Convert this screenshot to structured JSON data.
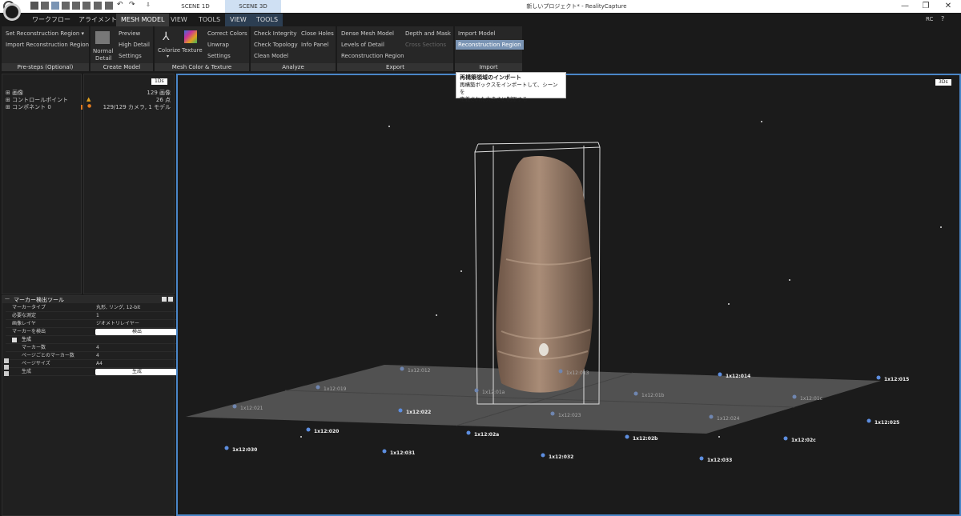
{
  "titlebar": {
    "scene_tabs": [
      "SCENE 1D",
      "SCENE 3D"
    ],
    "window_title": "新しいプロジェクト* - RealityCapture",
    "rc_label": "RC"
  },
  "menu": {
    "tabs": [
      "ワークフロー",
      "アライメント",
      "MESH MODEL",
      "VIEW",
      "TOOLS",
      "VIEW",
      "TOOLS"
    ]
  },
  "ribbon": {
    "prestep": {
      "label": "Pre-steps (Optional)",
      "items": [
        "Set Reconstruction Region ▾",
        "Import Reconstruction Region"
      ]
    },
    "create": {
      "label": "Create Model",
      "normal": "Normal",
      "detail": "Detail",
      "items": [
        "Preview",
        "High Detail",
        "Settings"
      ]
    },
    "color": {
      "label": "Mesh Color & Texture",
      "colorize": "Colorize",
      "texture": "Texture",
      "items": [
        "Correct Colors",
        "Unwrap",
        "Settings"
      ]
    },
    "analyze": {
      "label": "Analyze",
      "col1": [
        "Check Integrity",
        "Check Topology",
        "Clean Model"
      ],
      "col2": [
        "Close Holes",
        "Info Panel"
      ]
    },
    "export": {
      "label": "Export",
      "col1": [
        "Dense Mesh Model",
        "Levels of Detail",
        "Reconstruction Region"
      ],
      "col2": [
        "Depth and Mask",
        "Cross Sections"
      ]
    },
    "import": {
      "label": "Import",
      "items": [
        "Import Model",
        "Reconstruction Region"
      ]
    }
  },
  "tree": {
    "badge": "1Ds",
    "rows": [
      {
        "name": "画像",
        "value": "129 画像"
      },
      {
        "name": "コントロールポイント",
        "value": "26 点"
      },
      {
        "name": "コンポネント 0",
        "value": "129/129 カメラ, 1 モデル"
      }
    ]
  },
  "marker_tool": {
    "title": "マーカー検出ツール",
    "rows": [
      {
        "key": "マーカータイプ",
        "value": "丸形, リング, 12-bit"
      },
      {
        "key": "必要な測定",
        "value": "1"
      },
      {
        "key": "画像レイヤ",
        "value": "ジオメトリレイヤー"
      },
      {
        "key": "マーカーを検出",
        "button": "検出"
      }
    ],
    "section": "生成",
    "sub_rows": [
      {
        "key": "マーカー数",
        "value": "4"
      },
      {
        "key": "ページごとのマーカー数",
        "value": "4"
      },
      {
        "key": "ページサイズ",
        "value": "A4"
      },
      {
        "key": "生成",
        "button": "生成"
      }
    ]
  },
  "viewport": {
    "badge": "3Ds",
    "tooltip_title": "再構築領域のインポート",
    "tooltip_text1": "再構築ボックスをインポートして、シーンを",
    "tooltip_text2": "定義された大きさに制限する",
    "markers": [
      {
        "label": "1x12:012",
        "bright": false
      },
      {
        "label": "1x12:013",
        "bright": false
      },
      {
        "label": "1x12:014",
        "bright": true
      },
      {
        "label": "1x12:015",
        "bright": true
      },
      {
        "label": "1x12:019",
        "bright": false
      },
      {
        "label": "1x12:01a",
        "bright": false
      },
      {
        "label": "1x12:01b",
        "bright": false
      },
      {
        "label": "1x12:01c",
        "bright": false
      },
      {
        "label": "1x12:021",
        "bright": false
      },
      {
        "label": "1x12:022",
        "bright": true
      },
      {
        "label": "1x12:023",
        "bright": false
      },
      {
        "label": "1x12:024",
        "bright": false
      },
      {
        "label": "1x12:025",
        "bright": true
      },
      {
        "label": "1x12:020",
        "bright": true
      },
      {
        "label": "1x12:02a",
        "bright": true
      },
      {
        "label": "1x12:02b",
        "bright": true
      },
      {
        "label": "1x12:02c",
        "bright": true
      },
      {
        "label": "1x12:030",
        "bright": true
      },
      {
        "label": "1x12:031",
        "bright": true
      },
      {
        "label": "1x12:032",
        "bright": true
      },
      {
        "label": "1x12:033",
        "bright": true
      }
    ]
  }
}
